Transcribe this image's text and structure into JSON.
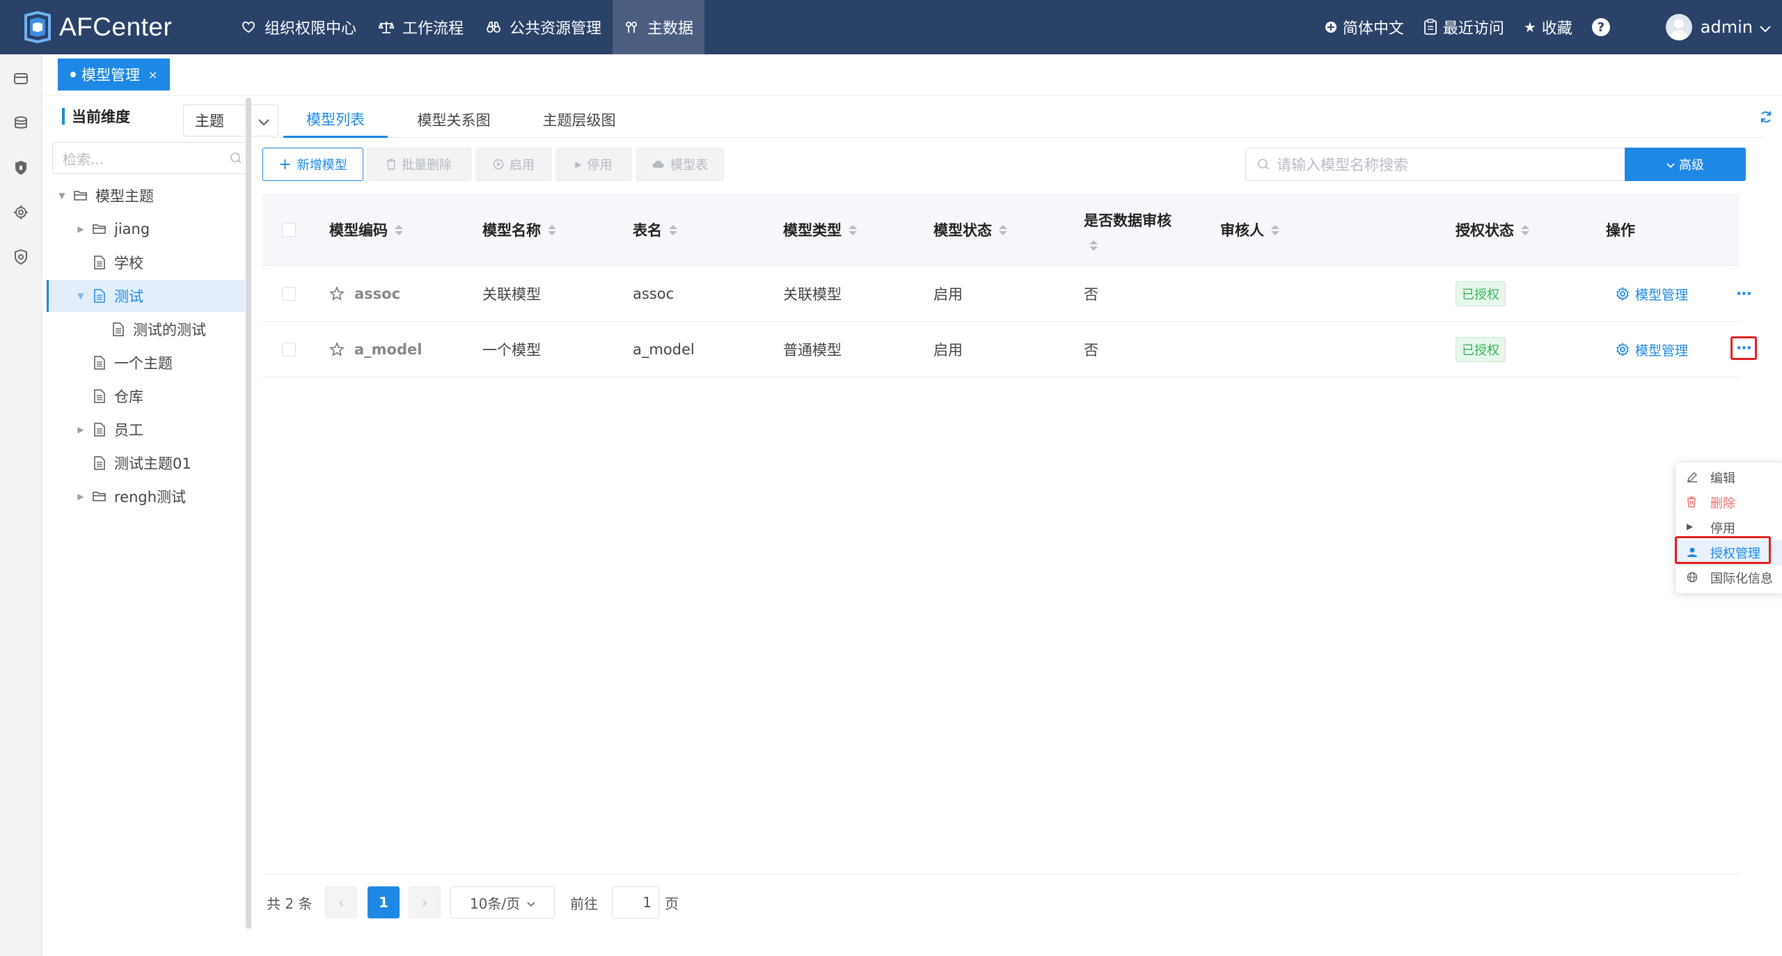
{
  "app": {
    "title": "AFCenter"
  },
  "nav": {
    "items": [
      {
        "label": "组织权限中心",
        "icon": "shield-heart-icon"
      },
      {
        "label": "工作流程",
        "icon": "scale-icon"
      },
      {
        "label": "公共资源管理",
        "icon": "binoculars-icon"
      },
      {
        "label": "主数据",
        "icon": "pin-icon"
      }
    ],
    "active": "主数据"
  },
  "nav_right": {
    "language": "简体中文",
    "recent": "最近访问",
    "favorite": "收藏",
    "help": "?",
    "user": "admin"
  },
  "tabs": {
    "current": "模型管理",
    "close": "×"
  },
  "tree": {
    "dimension_label": "当前维度",
    "dimension_value": "主题",
    "search_placeholder": "检索...",
    "nodes": [
      {
        "label": "模型主题",
        "expanded": true
      },
      {
        "label": "jiang"
      },
      {
        "label": "学校"
      },
      {
        "label": "测试",
        "selected": true
      },
      {
        "label": "测试的测试"
      },
      {
        "label": "一个主题"
      },
      {
        "label": "仓库"
      },
      {
        "label": "员工"
      },
      {
        "label": "测试主题01"
      },
      {
        "label": "rengh测试"
      }
    ]
  },
  "sub_tabs": [
    "模型列表",
    "模型关系图",
    "主题层级图"
  ],
  "toolbar": {
    "add": "新增模型",
    "batch_delete": "批量删除",
    "enable": "启用",
    "disable": "停用",
    "model_table": "模型表",
    "search_placeholder": "请输入模型名称搜索",
    "advanced": "高级"
  },
  "table": {
    "columns": [
      "模型编码",
      "模型名称",
      "表名",
      "模型类型",
      "模型状态",
      "是否数据审核",
      "审核人",
      "授权状态",
      "操作"
    ],
    "rows": [
      {
        "code": "assoc",
        "name": "关联模型",
        "table": "assoc",
        "type": "关联模型",
        "status": "启用",
        "audit": "否",
        "reviewer": "",
        "auth": "已授权",
        "action": "模型管理",
        "more": "···"
      },
      {
        "code": "a_model",
        "name": "一个模型",
        "table": "a_model",
        "type": "普通模型",
        "status": "启用",
        "audit": "否",
        "reviewer": "",
        "auth": "已授权",
        "action": "模型管理",
        "more": "···"
      }
    ]
  },
  "dropdown": {
    "items": [
      {
        "label": "编辑",
        "icon": "pencil-icon"
      },
      {
        "label": "删除",
        "icon": "trash-icon"
      },
      {
        "label": "停用",
        "icon": "play-triangle-icon"
      },
      {
        "label": "授权管理",
        "icon": "user-icon"
      },
      {
        "label": "国际化信息",
        "icon": "globe-icon"
      }
    ]
  },
  "pager": {
    "total": "共 2 条",
    "prev": "‹",
    "current": "1",
    "next": "›",
    "page_size": "10条/页",
    "goto_label": "前往",
    "goto_value": "1",
    "page_suffix": "页"
  },
  "colors": {
    "primary": "#1e88e5",
    "topbar": "#2a4168",
    "success": "#35b35e",
    "danger": "#f56c6c",
    "highlight_box": "#e02020"
  }
}
